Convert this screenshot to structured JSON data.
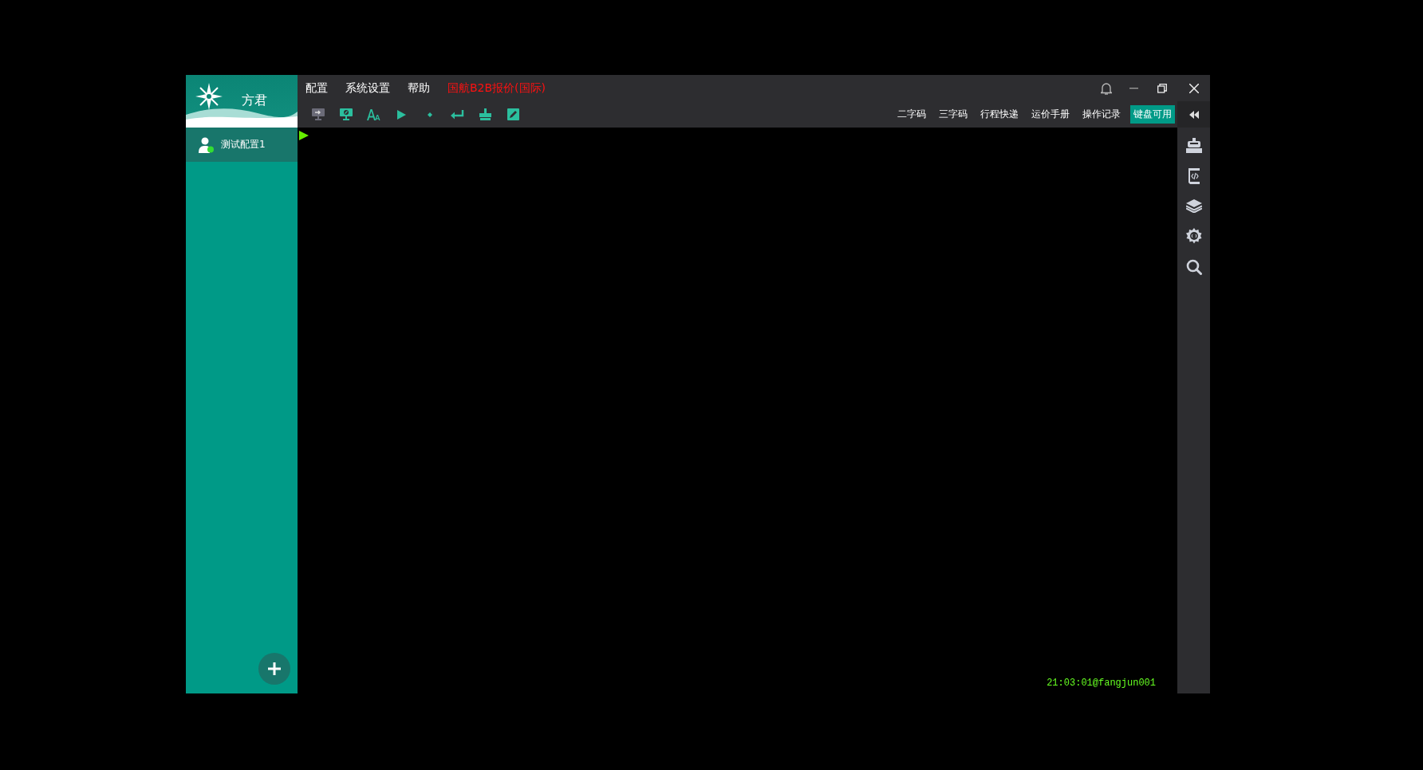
{
  "sidebar": {
    "brand": "方君",
    "profiles": [
      {
        "name": "测试配置1",
        "online": true,
        "selected": true
      }
    ]
  },
  "menu": [
    {
      "label": "配置",
      "kind": "plain"
    },
    {
      "label": "系统设置",
      "kind": "plain"
    },
    {
      "label": "帮助",
      "kind": "plain"
    },
    {
      "label": "国航B2B报价(国际)",
      "kind": "alert"
    }
  ],
  "toolbar": {
    "tools": [
      {
        "kind": "screen-add"
      },
      {
        "kind": "screen-off"
      },
      {
        "kind": "font"
      },
      {
        "kind": "play"
      },
      {
        "kind": "dot"
      },
      {
        "kind": "enter"
      },
      {
        "kind": "stamp"
      },
      {
        "kind": "edit"
      }
    ],
    "links": [
      {
        "label": "二字码",
        "selected": false
      },
      {
        "label": "三字码",
        "selected": false
      },
      {
        "label": "行程快递",
        "selected": false
      },
      {
        "label": "运价手册",
        "selected": false
      },
      {
        "label": "操作记录",
        "selected": false
      },
      {
        "label": "键盘可用",
        "selected": true
      }
    ]
  },
  "side_tools": [
    {
      "kind": "stamp"
    },
    {
      "kind": "code"
    },
    {
      "kind": "layers"
    },
    {
      "kind": "gear"
    },
    {
      "kind": "search"
    }
  ],
  "terminal": {
    "status": "21:03:01@fangjun001"
  }
}
